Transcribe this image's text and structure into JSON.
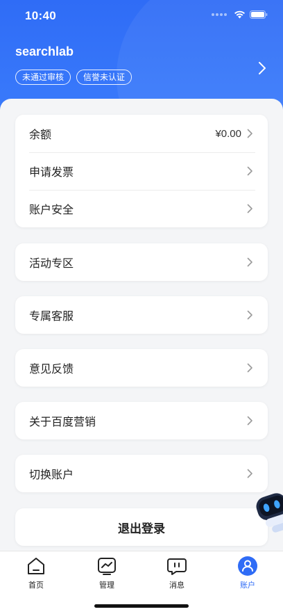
{
  "status_bar": {
    "time": "10:40"
  },
  "header": {
    "username": "searchlab",
    "badges": [
      "未通过审核",
      "信誉未认证"
    ]
  },
  "account_card": [
    {
      "label": "余额",
      "value": "¥0.00"
    },
    {
      "label": "申请发票",
      "value": ""
    },
    {
      "label": "账户安全",
      "value": ""
    }
  ],
  "menu": {
    "activity": "活动专区",
    "service": "专属客服",
    "feedback": "意见反馈",
    "about": "关于百度营销",
    "switch": "切换账户"
  },
  "logout_label": "退出登录",
  "tabs": [
    {
      "label": "首页",
      "icon": "home-icon"
    },
    {
      "label": "管理",
      "icon": "chart-icon"
    },
    {
      "label": "消息",
      "icon": "message-icon"
    },
    {
      "label": "账户",
      "icon": "account-icon",
      "active": true
    }
  ],
  "colors": {
    "primary": "#2f6cf6",
    "background": "#f4f5f7"
  }
}
